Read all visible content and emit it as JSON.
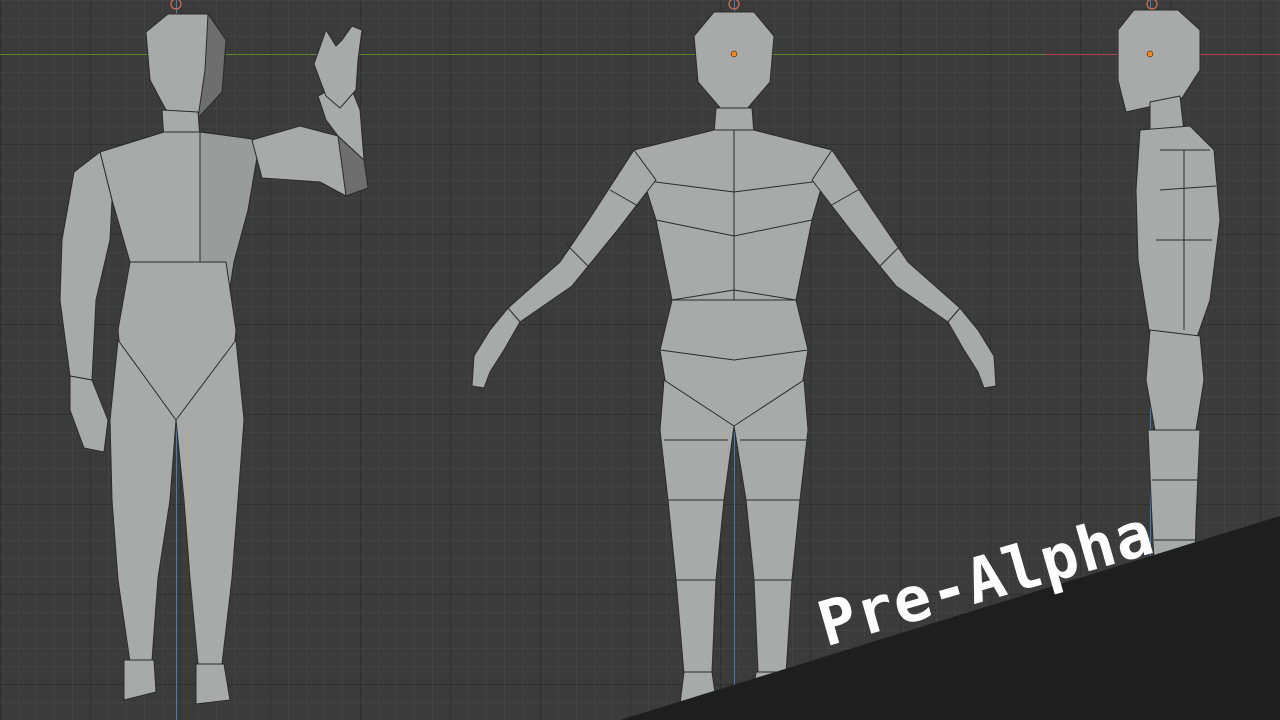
{
  "banner": {
    "label": "Pre-Alpha"
  },
  "colors": {
    "grid_background": "#3b3b3b",
    "x_axis_green": "#5c8a2a",
    "x_axis_red": "#b44444",
    "z_axis_blue": "#4a7ab0",
    "mesh_fill": "#a8aaa9",
    "mesh_edge": "#2b2b2b",
    "origin_point": "#f08a1c",
    "banner_background": "#1e1e1e",
    "banner_text": "#ffffff"
  },
  "views": [
    {
      "name": "perspective-waving-pose",
      "icon": "humanoid-mesh-icon"
    },
    {
      "name": "front-orthographic-a-pose",
      "icon": "humanoid-mesh-icon"
    },
    {
      "name": "side-orthographic-pose",
      "icon": "humanoid-mesh-icon"
    }
  ]
}
